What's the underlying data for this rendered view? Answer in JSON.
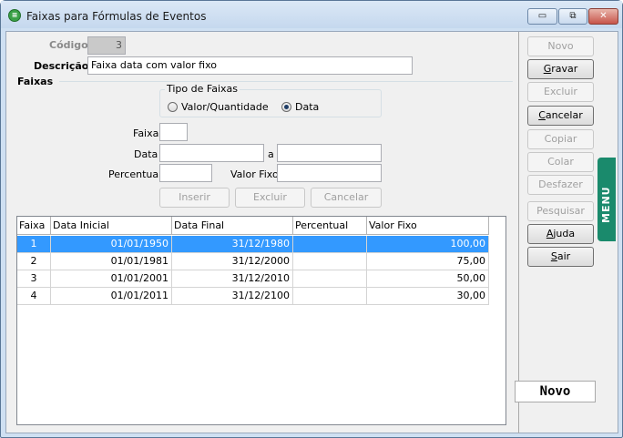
{
  "window": {
    "title": "Faixas para Fórmulas de Eventos",
    "min": "▭",
    "max": "⧉",
    "close": "✕"
  },
  "form": {
    "codigo_label": "Código",
    "codigo_value": "3",
    "descricao_label": "Descrição",
    "descricao_value": "Faixa data com valor fixo",
    "faixas_label": "Faixas",
    "tipo_label": "Tipo de Faixas",
    "radio_valor": "Valor/Quantidade",
    "radio_data": "Data",
    "selected_tipo": "Data",
    "faixa_label": "Faixa",
    "faixa_value": "",
    "data_label": "Data",
    "data_a_label": "a",
    "data_from": "",
    "data_to": "",
    "percentual_label": "Percentual",
    "percentual_value": "",
    "valor_fixo_label": "Valor Fixo",
    "valor_fixo_value": ""
  },
  "inner_buttons": {
    "inserir": "Inserir",
    "excluir": "Excluir",
    "cancelar": "Cancelar"
  },
  "grid": {
    "columns": [
      "Faixa",
      "Data Inicial",
      "Data Final",
      "Percentual",
      "Valor Fixo"
    ],
    "rows": [
      {
        "faixa": "1",
        "inicial": "01/01/1950",
        "final": "31/12/1980",
        "percentual": "",
        "valor": "100,00",
        "selected": true
      },
      {
        "faixa": "2",
        "inicial": "01/01/1981",
        "final": "31/12/2000",
        "percentual": "",
        "valor": "75,00",
        "selected": false
      },
      {
        "faixa": "3",
        "inicial": "01/01/2001",
        "final": "31/12/2010",
        "percentual": "",
        "valor": "50,00",
        "selected": false
      },
      {
        "faixa": "4",
        "inicial": "01/01/2011",
        "final": "31/12/2100",
        "percentual": "",
        "valor": "30,00",
        "selected": false
      }
    ]
  },
  "side_buttons": {
    "novo": "Novo",
    "gravar": "Gravar",
    "excluir": "Excluir",
    "cancelar": "Cancelar",
    "copiar": "Copiar",
    "colar": "Colar",
    "desfazer": "Desfazer",
    "pesquisar": "Pesquisar",
    "ajuda": "Ajuda",
    "sair": "Sair"
  },
  "menu_tab": "MENU",
  "status": "Novo",
  "colors": {
    "accent": "#3399ff",
    "menu_tab": "#1a8a6c"
  }
}
